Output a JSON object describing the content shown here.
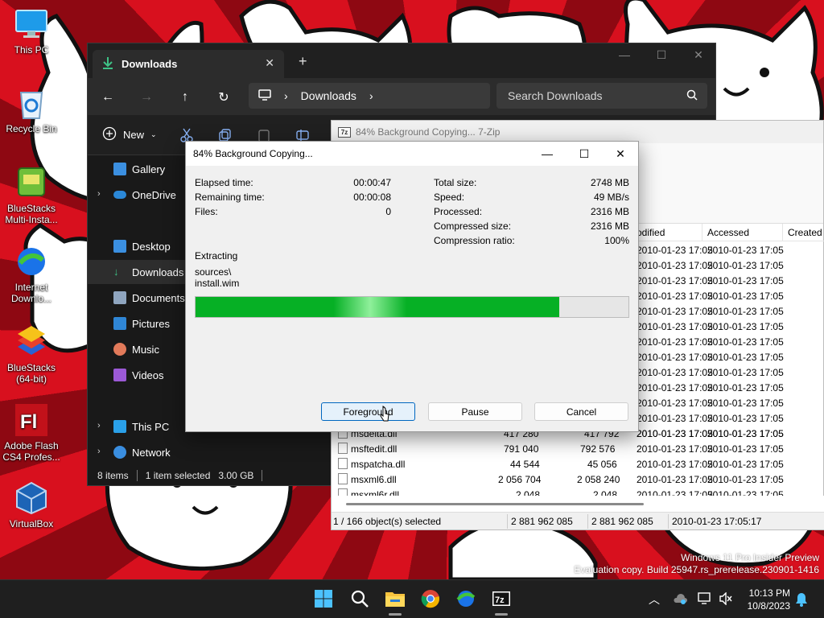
{
  "desktop": {
    "icons": [
      {
        "label": "This PC"
      },
      {
        "label": "Recycle Bin"
      },
      {
        "label": "BlueStacks Multi-Insta..."
      },
      {
        "label": "Internet Downlo..."
      },
      {
        "label": "BlueStacks (64-bit)"
      },
      {
        "label": "Adobe Flash CS4 Profes..."
      },
      {
        "label": "VirtualBox"
      }
    ],
    "watermark_line1": "Windows 11 Pro Insider Preview",
    "watermark_line2": "Evaluation copy. Build 25947.rs_prerelease.230901-1416"
  },
  "explorer": {
    "tab_title": "Downloads",
    "address": "Downloads",
    "search_placeholder": "Search Downloads",
    "new_label": "New",
    "sidebar": [
      {
        "label": "Gallery"
      },
      {
        "label": "OneDrive"
      },
      {
        "label": "Desktop"
      },
      {
        "label": "Downloads"
      },
      {
        "label": "Documents"
      },
      {
        "label": "Pictures"
      },
      {
        "label": "Music"
      },
      {
        "label": "Videos"
      },
      {
        "label": "This PC"
      },
      {
        "label": "Network"
      }
    ],
    "status": {
      "items": "8 items",
      "selected": "1 item selected",
      "size": "3.00 GB"
    }
  },
  "zip_fm": {
    "title": "84% Background Copying... 7-Zip",
    "columns": {
      "modified": "odified",
      "accessed": "Accessed",
      "created": "Created"
    },
    "partial_rows": [
      {
        "modified": "2010-01-23 17:05",
        "accessed": "2010-01-23 17:05"
      },
      {
        "modified": "2010-01-23 17:05",
        "accessed": "2010-01-23 17:05"
      },
      {
        "modified": "2010-01-23 17:05",
        "accessed": "2010-01-23 17:05"
      },
      {
        "modified": "2010-01-23 17:05",
        "accessed": "2010-01-23 17:05"
      },
      {
        "modified": "2010-01-23 17:05",
        "accessed": "2010-01-23 17:05"
      },
      {
        "modified": "2010-01-23 17:05",
        "accessed": "2010-01-23 17:05"
      },
      {
        "modified": "2010-01-23 17:05",
        "accessed": "2010-01-23 17:05"
      },
      {
        "modified": "2010-01-23 17:05",
        "accessed": "2010-01-23 17:05"
      },
      {
        "modified": "2010-01-23 17:05",
        "accessed": "2010-01-23 17:05"
      },
      {
        "modified": "2010-01-23 17:05",
        "accessed": "2010-01-23 17:05"
      },
      {
        "modified": "2010-01-23 17:05",
        "accessed": "2010-01-23 17:05"
      },
      {
        "modified": "2010-01-23 17:05",
        "accessed": "2010-01-23 17:05"
      },
      {
        "modified": "2010-01-23 17:05",
        "accessed": "2010-01-23 17:05"
      }
    ],
    "rows": [
      {
        "name": "msdelta.dll",
        "size": "417 280",
        "packed": "417 792",
        "modified": "2010-01-23 17:05",
        "accessed": "2010-01-23 17:05"
      },
      {
        "name": "msftedit.dll",
        "size": "791 040",
        "packed": "792 576",
        "modified": "2010-01-23 17:05",
        "accessed": "2010-01-23 17:05"
      },
      {
        "name": "mspatcha.dll",
        "size": "44 544",
        "packed": "45 056",
        "modified": "2010-01-23 17:05",
        "accessed": "2010-01-23 17:05"
      },
      {
        "name": "msxml6.dll",
        "size": "2 056 704",
        "packed": "2 058 240",
        "modified": "2010-01-23 17:05",
        "accessed": "2010-01-23 17:05"
      },
      {
        "name": "msxml6r.dll",
        "size": "2 048",
        "packed": "2 048",
        "modified": "2010-01-23 17:05",
        "accessed": "2010-01-23 17:05"
      }
    ],
    "status": {
      "selection": "1 / 166 object(s) selected",
      "size": "2 881 962 085",
      "packed": "2 881 962 085",
      "date": "2010-01-23 17:05:17"
    }
  },
  "dialog": {
    "title": "84% Background Copying...",
    "left": [
      {
        "label": "Elapsed time:",
        "value": "00:00:47"
      },
      {
        "label": "Remaining time:",
        "value": "00:00:08"
      },
      {
        "label": "Files:",
        "value": "0"
      }
    ],
    "right": [
      {
        "label": "Total size:",
        "value": "2748 MB"
      },
      {
        "label": "Speed:",
        "value": "49 MB/s"
      },
      {
        "label": "Processed:",
        "value": "2316 MB"
      },
      {
        "label": "Compressed size:",
        "value": "2316 MB"
      },
      {
        "label": "Compression ratio:",
        "value": "100%"
      }
    ],
    "operation": "Extracting",
    "path1": "sources\\",
    "path2": "install.wim",
    "progress_fraction": 0.84,
    "buttons": {
      "foreground": "Foreground",
      "pause": "Pause",
      "cancel": "Cancel"
    }
  },
  "taskbar": {
    "apps": [
      "windows-start-icon",
      "search-icon",
      "file-explorer-icon",
      "chrome-icon",
      "internet-download-manager-icon",
      "7zip-icon"
    ],
    "time": "10:13 PM",
    "date": "10/8/2023"
  }
}
